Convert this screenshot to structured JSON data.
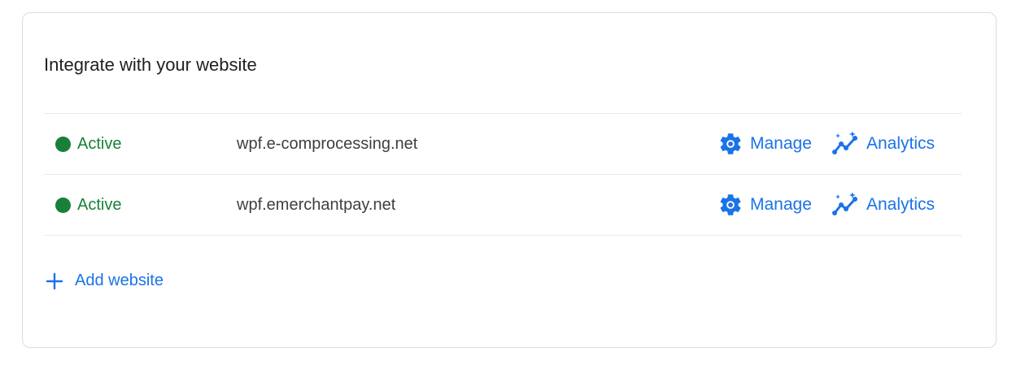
{
  "card": {
    "title": "Integrate with your website"
  },
  "websites": [
    {
      "status": "Active",
      "domain": "wpf.e-comprocessing.net",
      "manage_label": "Manage",
      "analytics_label": "Analytics"
    },
    {
      "status": "Active",
      "domain": "wpf.emerchantpay.net",
      "manage_label": "Manage",
      "analytics_label": "Analytics"
    }
  ],
  "add_website_label": "Add website",
  "icons": {
    "status": "status-dot-icon",
    "manage": "gear-icon",
    "analytics": "analytics-sparkle-icon",
    "add": "plus-icon"
  },
  "colors": {
    "active_green": "#188038",
    "link_blue": "#1a73e8",
    "divider": "#e8eaed",
    "border": "#dadce0"
  }
}
